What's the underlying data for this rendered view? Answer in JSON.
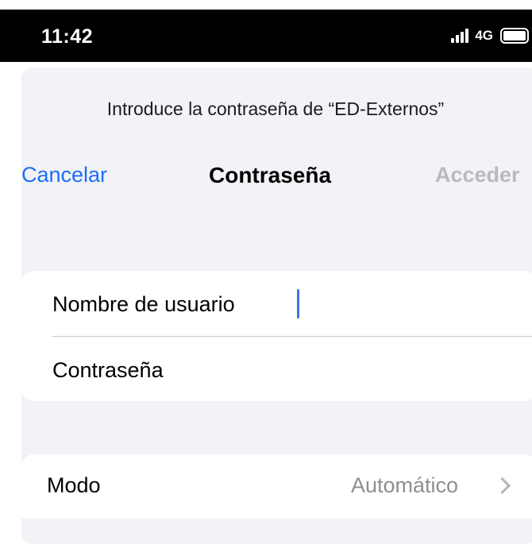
{
  "status_bar": {
    "time": "11:42",
    "network": "4G"
  },
  "prompt": "Introduce la contraseña de “ED-Externos”",
  "nav": {
    "cancel": "Cancelar",
    "title": "Contraseña",
    "login": "Acceder"
  },
  "form": {
    "username_label": "Nombre de usuario",
    "password_label": "Contraseña"
  },
  "mode": {
    "label": "Modo",
    "value": "Automático"
  }
}
